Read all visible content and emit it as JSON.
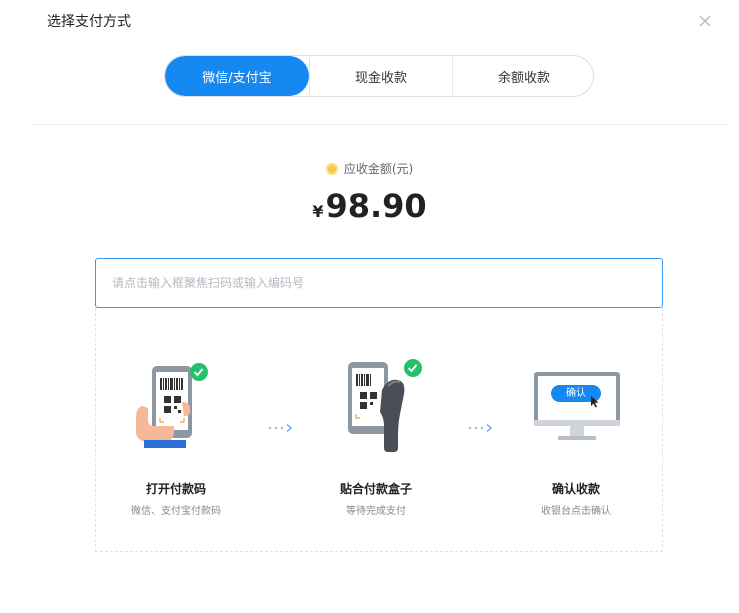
{
  "dialog": {
    "title": "选择支付方式"
  },
  "tabs": [
    {
      "label": "微信/支付宝",
      "active": true
    },
    {
      "label": "现金收款",
      "active": false
    },
    {
      "label": "余额收款",
      "active": false
    }
  ],
  "amount": {
    "label": "应收金额(元)",
    "currency": "¥",
    "value": "98.90"
  },
  "scan": {
    "placeholder": "请点击输入框聚焦扫码或输入编码号"
  },
  "steps": [
    {
      "title": "打开付款码",
      "subtitle": "微信、支付宝付款码"
    },
    {
      "title": "贴合付款盒子",
      "subtitle": "等待完成支付"
    },
    {
      "title": "确认收款",
      "subtitle": "收银台点击确认",
      "screen_button": "确认"
    }
  ],
  "colors": {
    "accent": "#1688f2",
    "success": "#27c06a",
    "coin": "#f7c843"
  }
}
